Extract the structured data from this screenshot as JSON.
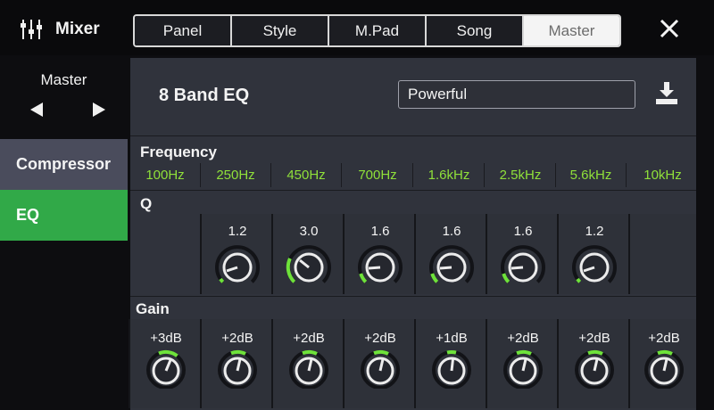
{
  "header": {
    "title": "Mixer",
    "tabs": [
      {
        "label": "Panel",
        "active": false
      },
      {
        "label": "Style",
        "active": false
      },
      {
        "label": "M.Pad",
        "active": false
      },
      {
        "label": "Song",
        "active": false
      },
      {
        "label": "Master",
        "active": true
      }
    ],
    "icons": {
      "app": "mixer-sliders-icon",
      "close": "close-icon"
    }
  },
  "sidebar": {
    "part_label": "Master",
    "items": [
      {
        "label": "Compressor",
        "selected": false
      },
      {
        "label": "EQ",
        "selected": true
      }
    ]
  },
  "eq": {
    "title": "8 Band EQ",
    "preset": "Powerful",
    "save_icon": "save-icon",
    "frequency_label": "Frequency",
    "q_label": "Q",
    "gain_label": "Gain",
    "frequencies": [
      "100Hz",
      "250Hz",
      "450Hz",
      "700Hz",
      "1.6kHz",
      "2.5kHz",
      "5.6kHz",
      "10kHz"
    ],
    "q_values": [
      "1.2",
      "3.0",
      "1.6",
      "1.6",
      "1.6",
      "1.2"
    ],
    "gains": [
      "+3dB",
      "+2dB",
      "+2dB",
      "+2dB",
      "+1dB",
      "+2dB",
      "+2dB",
      "+2dB"
    ]
  },
  "colors": {
    "accent": "#31a948",
    "frequency_text": "#8fe03a",
    "knob_arc": "#6ee23a"
  }
}
